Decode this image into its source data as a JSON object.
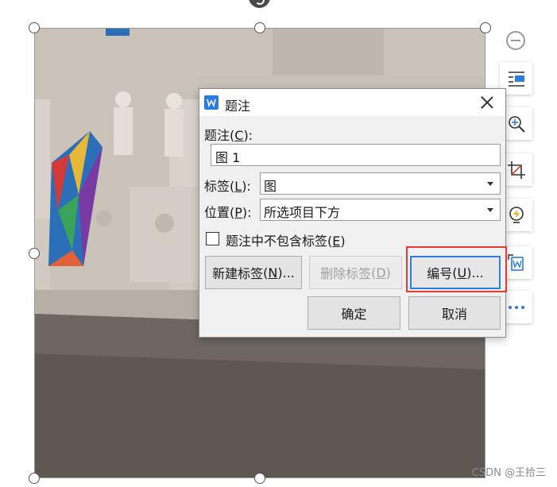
{
  "dialog": {
    "title": "题注",
    "caption_label": "题注",
    "caption_key": "C",
    "caption_value": "图 1",
    "tag_label": "标签",
    "tag_key": "L",
    "tag_value": "图",
    "position_label": "位置",
    "position_key": "P",
    "position_value": "所选项目下方",
    "exclude_label": "题注中不包含标签",
    "exclude_key": "E",
    "exclude_checked": false,
    "new_label_button": "新建标签",
    "new_label_key": "N",
    "delete_label_button": "删除标签",
    "delete_label_key": "D",
    "numbering_button": "编号",
    "numbering_key": "U",
    "ok_button": "确定",
    "cancel_button": "取消"
  },
  "toolbar": {
    "items": [
      "zoom-out-icon",
      "wrap-text-icon",
      "zoom-in-icon",
      "crop-icon",
      "idea-icon",
      "image-to-doc-icon",
      "more-icon"
    ]
  },
  "watermark": "CSDN @王拾三",
  "colors": {
    "accent": "#2d7de0",
    "highlight": "#e53935",
    "app_icon": "#2c7be5"
  }
}
